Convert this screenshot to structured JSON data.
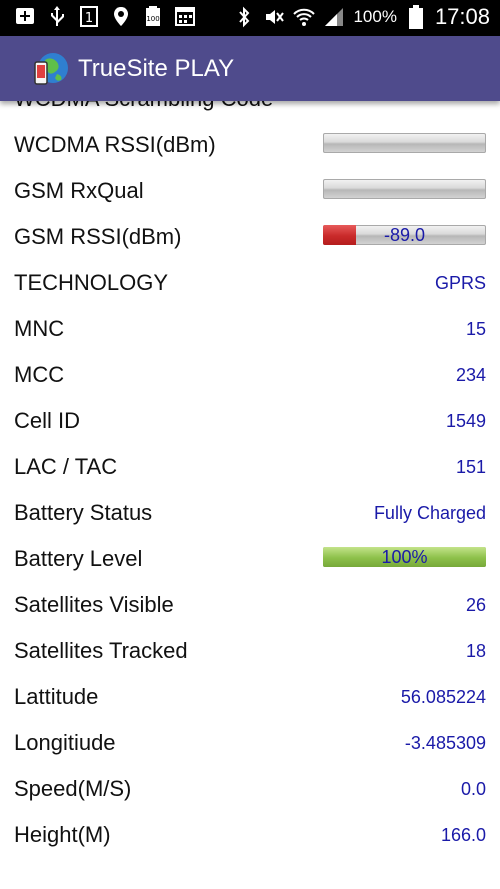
{
  "status_bar": {
    "battery_percent": "100%",
    "time": "17:08",
    "icons": [
      "add-box-icon",
      "usb-icon",
      "sim-1-icon",
      "location-icon",
      "battery-100-icon",
      "calendar-icon",
      "bluetooth-icon",
      "mute-icon",
      "wifi-icon",
      "signal-icon",
      "battery-icon"
    ]
  },
  "app_bar": {
    "title": "TrueSite PLAY"
  },
  "rows": [
    {
      "label": "WCDMA Scrambling Code",
      "value": "-"
    },
    {
      "label": "WCDMA RSSI(dBm)",
      "bar": {
        "fraction": 0,
        "text": ""
      }
    },
    {
      "label": "GSM RxQual",
      "bar": {
        "fraction": 0,
        "text": ""
      }
    },
    {
      "label": "GSM RSSI(dBm)",
      "bar": {
        "fraction": 0.2,
        "text": "-89.0",
        "color": "#c92a2a"
      }
    },
    {
      "label": "TECHNOLOGY",
      "value": "GPRS"
    },
    {
      "label": "MNC",
      "value": "15"
    },
    {
      "label": "MCC",
      "value": "234"
    },
    {
      "label": "Cell ID",
      "value": "1549"
    },
    {
      "label": "LAC / TAC",
      "value": "151"
    },
    {
      "label": "Battery Status",
      "value": "Fully Charged"
    },
    {
      "label": "Battery Level",
      "bar": {
        "fraction": 1.0,
        "text": "100%",
        "color": "#8dc04a"
      }
    },
    {
      "label": "Satellites Visible",
      "value": "26"
    },
    {
      "label": "Satellites Tracked",
      "value": "18"
    },
    {
      "label": "Lattitude",
      "value": "56.085224"
    },
    {
      "label": "Longitiude",
      "value": "-3.485309"
    },
    {
      "label": "Speed(M/S)",
      "value": "0.0"
    },
    {
      "label": "Height(M)",
      "value": "166.0"
    }
  ],
  "colors": {
    "app_bar": "#4f4b8c",
    "value_text": "#1a1aa8",
    "signal_bar_low": "#c92a2a",
    "battery_bar": "#8dc04a"
  }
}
